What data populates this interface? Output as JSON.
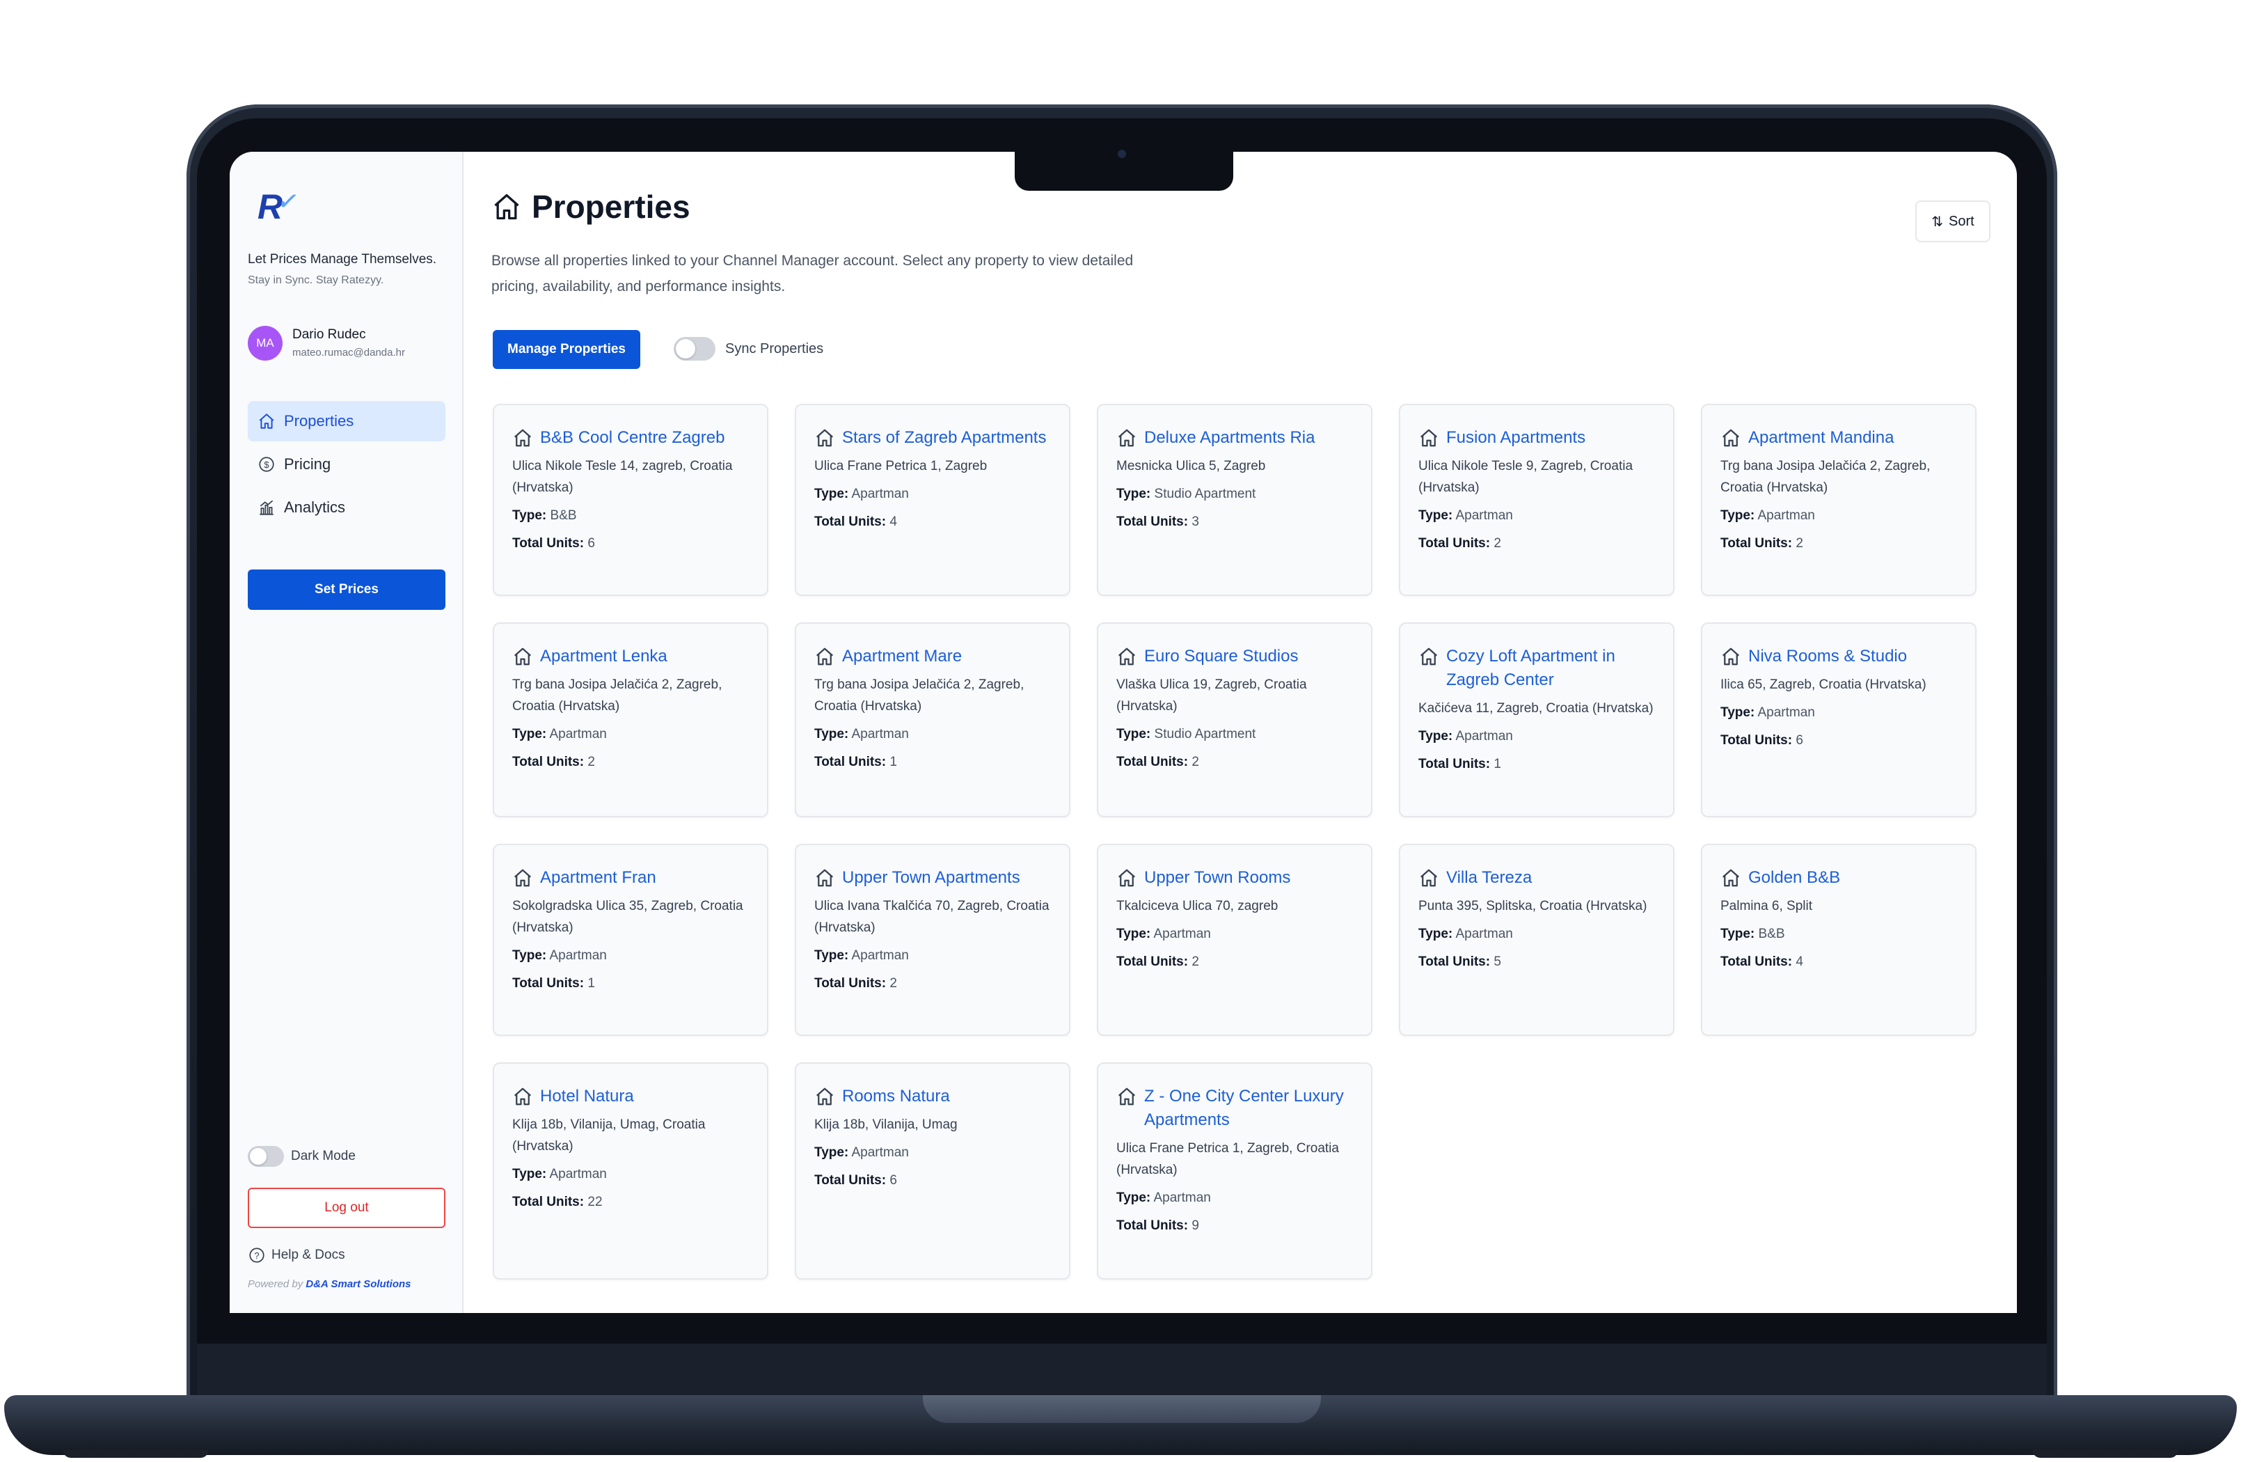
{
  "sidebar": {
    "logo": "R",
    "tagline": "Let Prices Manage Themselves.",
    "subtagline": "Stay in Sync. Stay Ratezyy.",
    "user": {
      "initials": "MA",
      "name": "Dario Rudec",
      "email": "mateo.rumac@danda.hr"
    },
    "nav": [
      {
        "label": "Properties",
        "icon": "home-icon"
      },
      {
        "label": "Pricing",
        "icon": "dollar-circle-icon"
      },
      {
        "label": "Analytics",
        "icon": "chart-icon"
      }
    ],
    "set_prices": "Set Prices",
    "dark_mode": "Dark Mode",
    "logout": "Log out",
    "help": "Help & Docs",
    "powered_prefix": "Powered by",
    "powered_company": "D&A Smart Solutions"
  },
  "main": {
    "title": "Properties",
    "description": "Browse all properties linked to your Channel Manager account. Select any property to view detailed pricing, availability, and performance insights.",
    "sort_label": "Sort",
    "manage_label": "Manage Properties",
    "sync_label": "Sync Properties",
    "type_label": "Type:",
    "units_label": "Total Units:",
    "properties": [
      {
        "name": "B&B Cool Centre Zagreb",
        "address": "Ulica Nikole Tesle 14, zagreb, Croatia (Hrvatska)",
        "type": "B&B",
        "units": "6"
      },
      {
        "name": "Stars of Zagreb Apartments",
        "address": "Ulica Frane Petrica 1, Zagreb",
        "type": "Apartman",
        "units": "4"
      },
      {
        "name": "Deluxe Apartments Ria",
        "address": "Mesnicka Ulica 5, Zagreb",
        "type": "Studio Apartment",
        "units": "3"
      },
      {
        "name": "Fusion Apartments",
        "address": "Ulica Nikole Tesle 9, Zagreb, Croatia (Hrvatska)",
        "type": "Apartman",
        "units": "2"
      },
      {
        "name": "Apartment Mandina",
        "address": "Trg bana Josipa Jelačića 2, Zagreb, Croatia (Hrvatska)",
        "type": "Apartman",
        "units": "2"
      },
      {
        "name": "Apartment Lenka",
        "address": "Trg bana Josipa Jelačića 2, Zagreb, Croatia (Hrvatska)",
        "type": "Apartman",
        "units": "2"
      },
      {
        "name": "Apartment Mare",
        "address": "Trg bana Josipa Jelačića 2, Zagreb, Croatia (Hrvatska)",
        "type": "Apartman",
        "units": "1"
      },
      {
        "name": "Euro Square Studios",
        "address": "Vlaška Ulica 19, Zagreb, Croatia (Hrvatska)",
        "type": "Studio Apartment",
        "units": "2"
      },
      {
        "name": "Cozy Loft Apartment in Zagreb Center",
        "address": "Kačićeva 11, Zagreb, Croatia (Hrvatska)",
        "type": "Apartman",
        "units": "1"
      },
      {
        "name": "Niva Rooms & Studio",
        "address": "Ilica 65, Zagreb, Croatia (Hrvatska)",
        "type": "Apartman",
        "units": "6"
      },
      {
        "name": "Apartment Fran",
        "address": "Sokolgradska Ulica 35, Zagreb, Croatia (Hrvatska)",
        "type": "Apartman",
        "units": "1"
      },
      {
        "name": "Upper Town Apartments",
        "address": "Ulica Ivana Tkalčića 70, Zagreb, Croatia (Hrvatska)",
        "type": "Apartman",
        "units": "2"
      },
      {
        "name": "Upper Town Rooms",
        "address": "Tkalciceva Ulica 70, zagreb",
        "type": "Apartman",
        "units": "2"
      },
      {
        "name": "Villa Tereza",
        "address": "Punta 395, Splitska, Croatia (Hrvatska)",
        "type": "Apartman",
        "units": "5"
      },
      {
        "name": "Golden B&B",
        "address": "Palmina 6, Split",
        "type": "B&B",
        "units": "4"
      },
      {
        "name": "Hotel Natura",
        "address": "Klija 18b, Vilanija, Umag, Croatia (Hrvatska)",
        "type": "Apartman",
        "units": "22"
      },
      {
        "name": "Rooms Natura",
        "address": "Klija 18b, Vilanija, Umag",
        "type": "Apartman",
        "units": "6"
      },
      {
        "name": "Z - One City Center Luxury Apartments",
        "address": "Ulica Frane Petrica 1, Zagreb, Croatia (Hrvatska)",
        "type": "Apartman",
        "units": "9"
      }
    ]
  },
  "colors": {
    "primary": "#0b55d8",
    "link": "#1d5ed8",
    "active_nav_bg": "#dbeafe",
    "danger": "#dc2626",
    "avatar": "#a855f7"
  }
}
